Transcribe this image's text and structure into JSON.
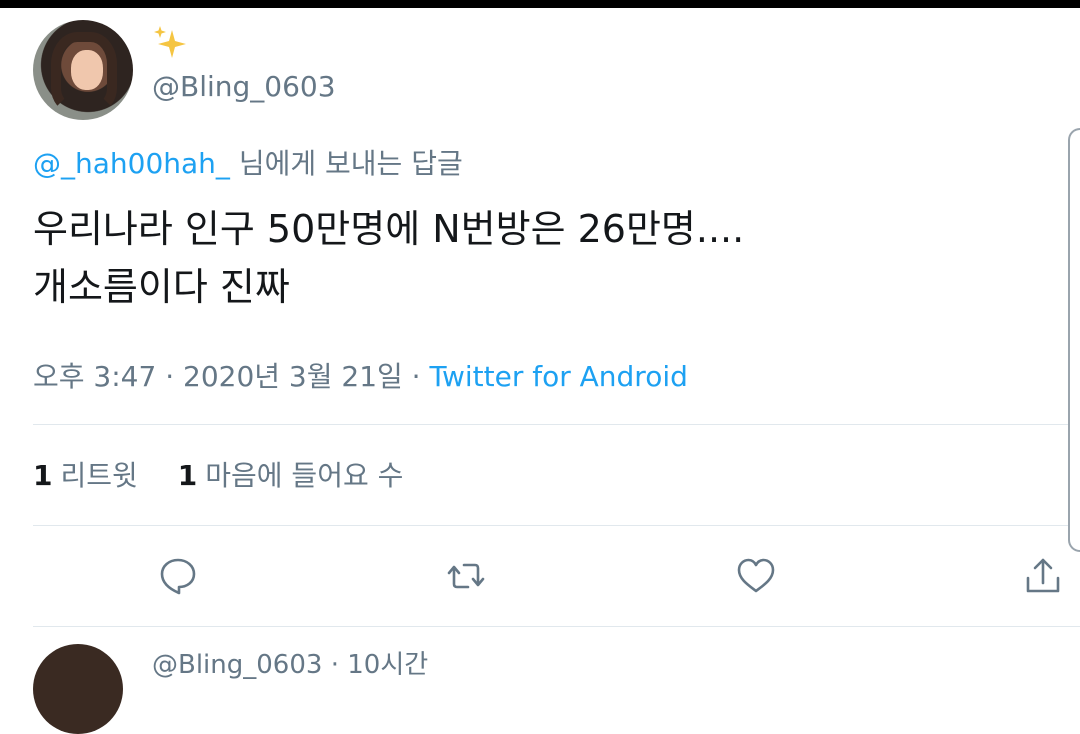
{
  "tweet": {
    "handle": "@Bling_0603",
    "reply_to_mention": "@_hah00hah_",
    "reply_to_suffix": " 님에게 보내는 답글",
    "text_line1": "우리나라 인구 50만명에 N번방은 26만명....",
    "text_line2": "개소름이다 진짜",
    "time": "오후 3:47 · 2020년 3월 21일 · ",
    "source": "Twitter for Android",
    "retweet_count": "1",
    "retweet_label": "리트윗",
    "like_count": "1",
    "like_label": "마음에 들어요 수"
  },
  "next_tweet": {
    "partial_text": "@Bling_0603 · 10시간"
  },
  "icons": {
    "reply": "reply-icon",
    "retweet": "retweet-icon",
    "like": "like-icon",
    "share": "share-icon",
    "sparkle": "sparkle-emoji"
  },
  "colors": {
    "link": "#1da1f2",
    "secondary_text": "#657786",
    "divider": "#e1e8ed",
    "sparkle": "#f5c542"
  }
}
